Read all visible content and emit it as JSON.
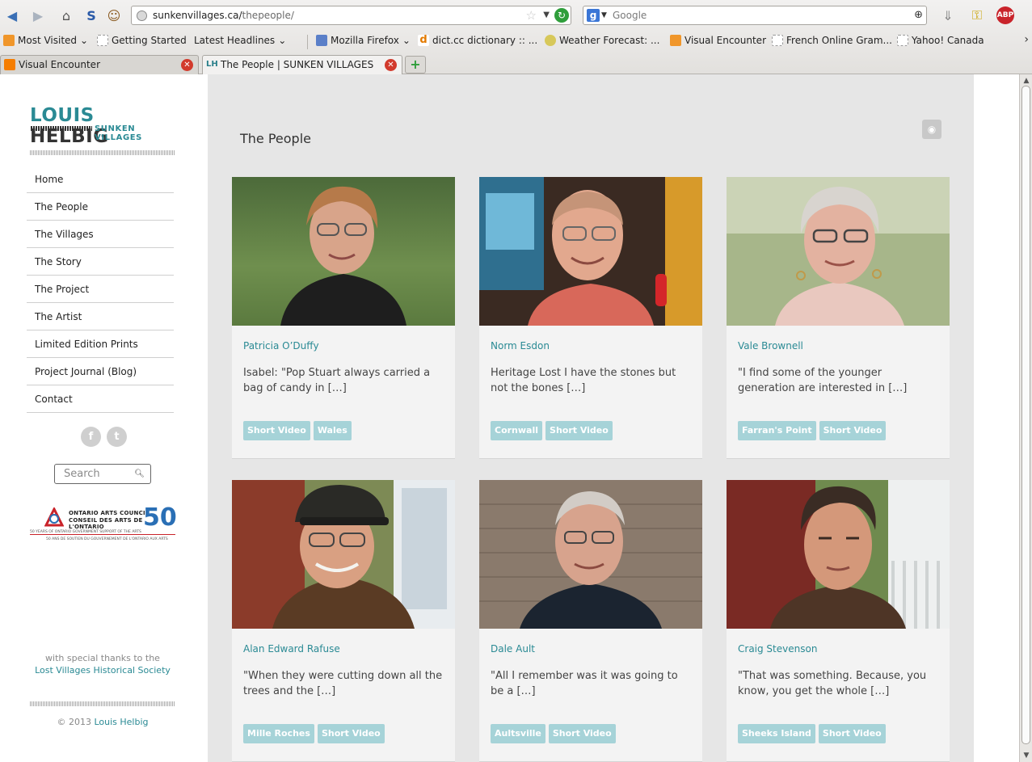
{
  "browser": {
    "url_host": "sunkenvillages.ca/",
    "url_path": "thepeople/",
    "search_placeholder": "Google",
    "bookmarks": [
      "Most Visited",
      "Getting Started",
      "Latest Headlines",
      "Mozilla Firefox",
      "dict.cc dictionary :: ...",
      "Weather Forecast: ...",
      "Visual Encounter",
      "French Online Gram...",
      "Yahoo! Canada"
    ],
    "tabs": [
      {
        "title": "Visual Encounter"
      },
      {
        "title": "The People | SUNKEN VILLAGES"
      }
    ]
  },
  "sidebar": {
    "logo_name_a": "LOUIS",
    "logo_name_b": " HELBIG",
    "logo_sub": "SUNKEN VILLAGES",
    "menu": [
      "Home",
      "The People",
      "The Villages",
      "The Story",
      "The Project",
      "The Artist",
      "Limited Edition Prints",
      "Project Journal (Blog)",
      "Contact"
    ],
    "search_placeholder": "Search",
    "oac_line1": "ONTARIO ARTS COUNCIL",
    "oac_line2": "CONSEIL DES ARTS DE L'ONTARIO",
    "oac_line3": "50 YEARS OF ONTARIO GOVERNMENT SUPPORT OF THE ARTS",
    "oac_line4": "50 ANS DE SOUTIEN DU GOUVERNEMENT DE L'ONTARIO AUX ARTS",
    "oac_fifty": "50",
    "thanks_text": "with special thanks to the",
    "thanks_link": "Lost Villages Historical Society",
    "copyright": "© 2013 ",
    "copyright_link": "Louis Helbig"
  },
  "main": {
    "title": "The People",
    "people": [
      {
        "name": "Patricia O’Duffy",
        "excerpt": "Isabel: \"Pop Stuart always carried a bag of candy in […]",
        "tags": [
          "Short Video",
          "Wales"
        ]
      },
      {
        "name": "Norm Esdon",
        "excerpt": "Heritage Lost I have the stones but not the bones […]",
        "tags": [
          "Cornwall",
          "Short Video"
        ]
      },
      {
        "name": "Vale Brownell",
        "excerpt": "\"I find some of the younger generation are interested in […]",
        "tags": [
          "Farran's Point",
          "Short Video"
        ]
      },
      {
        "name": "Alan Edward Rafuse",
        "excerpt": "\"When they were cutting down all the trees and the […]",
        "tags": [
          "Mille Roches",
          "Short Video"
        ]
      },
      {
        "name": "Dale Ault",
        "excerpt": "\"All I remember was it was going to be a […]",
        "tags": [
          "Aultsville",
          "Short Video"
        ]
      },
      {
        "name": "Craig Stevenson",
        "excerpt": "\"That was something. Because, you know, you get the whole […]",
        "tags": [
          "Sheeks Island",
          "Short Video"
        ]
      }
    ]
  }
}
